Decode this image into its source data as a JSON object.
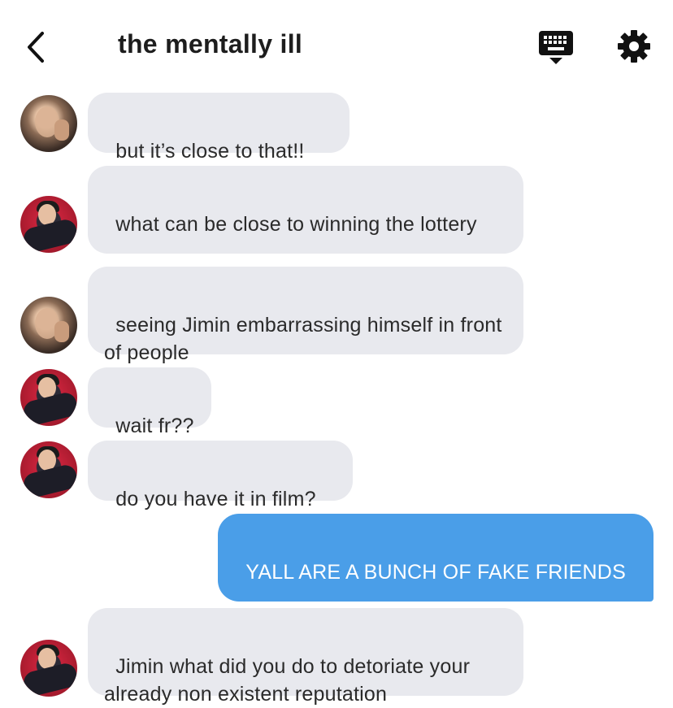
{
  "header": {
    "title": "the mentally ill",
    "back_icon": "chevron-left-icon",
    "keyboard_icon": "keyboard-icon",
    "settings_icon": "gear-icon"
  },
  "colors": {
    "incoming_bubble": "#e8e9ee",
    "outgoing_bubble": "#4a9ee8",
    "text": "#2a2a2a"
  },
  "messages": [
    {
      "sender": "friend-a",
      "text": "but it’s close to that!!"
    },
    {
      "sender": "friend-b",
      "text": "what can be close to winning the lottery"
    },
    {
      "sender": "friend-a",
      "text": "seeing Jimin embarrassing himself in front of people"
    },
    {
      "sender": "friend-b",
      "text": "wait fr??"
    },
    {
      "sender": "friend-b",
      "text": "do you have it in film?"
    },
    {
      "sender": "me",
      "text": "YALL ARE A BUNCH OF FAKE FRIENDS"
    },
    {
      "sender": "friend-b",
      "text": "Jimin what did you do to detoriate your already non existent reputation"
    }
  ]
}
